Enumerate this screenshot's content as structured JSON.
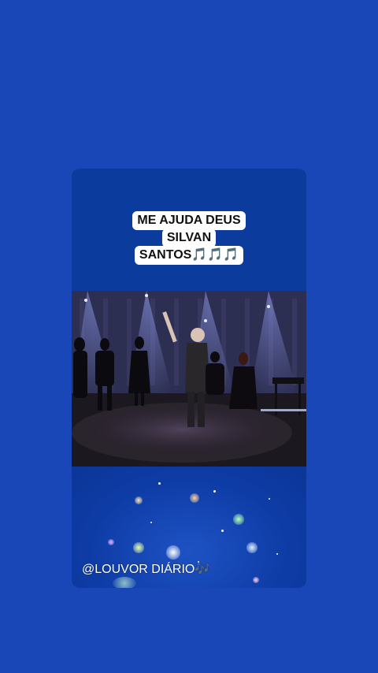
{
  "caption": {
    "line1": "ME AJUDA  DEUS",
    "line2": "SILVAN",
    "line3": "SANTOS",
    "line3_emoji": "🎵🎵🎵"
  },
  "footer": {
    "handle": "@LOUVOR DIÁRIO",
    "handle_emoji": "🎶"
  },
  "colors": {
    "background": "#1a47b8",
    "card": "#0c3b9e",
    "caption_bg": "#ffffff",
    "emoji_purple": "#8a2be2"
  },
  "icons": {
    "music_notes": "music-notes-icon",
    "double_note": "double-note-icon"
  }
}
